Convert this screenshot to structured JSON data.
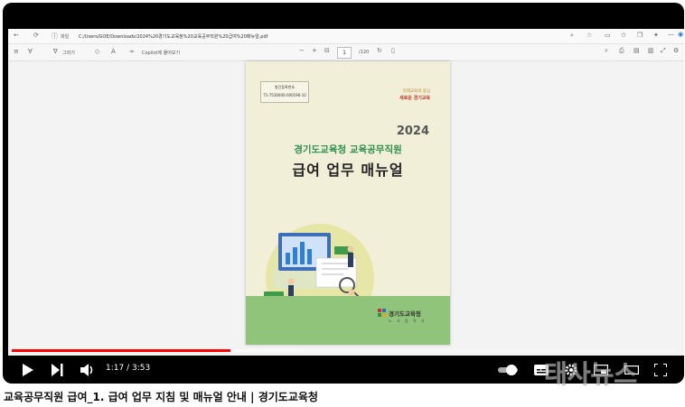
{
  "browser": {
    "tab_label": "파일",
    "url": "C:/Users/GOE/Downloads/2024%20경기도교육청%20교육공무직원%20급여%20매뉴얼.pdf",
    "tool_draw": "그리기",
    "tool_copilot": "Copilot에 물어보기",
    "page_number": "1",
    "page_total": "/120"
  },
  "document": {
    "registration_label": "발간등록번호",
    "registration_number": "71-7530000-000196-10",
    "slogan_line1": "미래교육의 중심",
    "slogan_line2": "새로운 경기교육",
    "year": "2024",
    "subtitle": "경기도교육청 교육공무직원",
    "title": "급여 업무 매뉴얼",
    "org_name": "경기도교육청",
    "org_sub": "노 사 협 력 과"
  },
  "player": {
    "time_current": "1:17",
    "time_separator": " / ",
    "time_total": "3:53",
    "progress_played": 0.33,
    "progress_buffered": 0.44
  },
  "watermark": "태사뉴스",
  "caption": "교육공무직원 급여_1. 급여 업무 지침 및 매뉴얼 안내 |  경기도교육청",
  "colors": {
    "progress": "#ff0000",
    "subtitle_green": "#2e8f4e",
    "footer_green": "#8fc47a"
  }
}
